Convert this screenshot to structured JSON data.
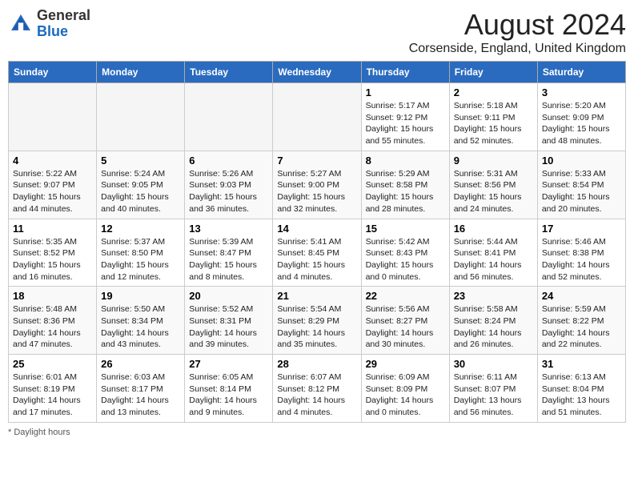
{
  "header": {
    "logo_line1": "General",
    "logo_line2": "Blue",
    "title": "August 2024",
    "subtitle": "Corsenside, England, United Kingdom"
  },
  "days_of_week": [
    "Sunday",
    "Monday",
    "Tuesday",
    "Wednesday",
    "Thursday",
    "Friday",
    "Saturday"
  ],
  "weeks": [
    [
      {
        "day": "",
        "info": ""
      },
      {
        "day": "",
        "info": ""
      },
      {
        "day": "",
        "info": ""
      },
      {
        "day": "",
        "info": ""
      },
      {
        "day": "1",
        "info": "Sunrise: 5:17 AM\nSunset: 9:12 PM\nDaylight: 15 hours and 55 minutes."
      },
      {
        "day": "2",
        "info": "Sunrise: 5:18 AM\nSunset: 9:11 PM\nDaylight: 15 hours and 52 minutes."
      },
      {
        "day": "3",
        "info": "Sunrise: 5:20 AM\nSunset: 9:09 PM\nDaylight: 15 hours and 48 minutes."
      }
    ],
    [
      {
        "day": "4",
        "info": "Sunrise: 5:22 AM\nSunset: 9:07 PM\nDaylight: 15 hours and 44 minutes."
      },
      {
        "day": "5",
        "info": "Sunrise: 5:24 AM\nSunset: 9:05 PM\nDaylight: 15 hours and 40 minutes."
      },
      {
        "day": "6",
        "info": "Sunrise: 5:26 AM\nSunset: 9:03 PM\nDaylight: 15 hours and 36 minutes."
      },
      {
        "day": "7",
        "info": "Sunrise: 5:27 AM\nSunset: 9:00 PM\nDaylight: 15 hours and 32 minutes."
      },
      {
        "day": "8",
        "info": "Sunrise: 5:29 AM\nSunset: 8:58 PM\nDaylight: 15 hours and 28 minutes."
      },
      {
        "day": "9",
        "info": "Sunrise: 5:31 AM\nSunset: 8:56 PM\nDaylight: 15 hours and 24 minutes."
      },
      {
        "day": "10",
        "info": "Sunrise: 5:33 AM\nSunset: 8:54 PM\nDaylight: 15 hours and 20 minutes."
      }
    ],
    [
      {
        "day": "11",
        "info": "Sunrise: 5:35 AM\nSunset: 8:52 PM\nDaylight: 15 hours and 16 minutes."
      },
      {
        "day": "12",
        "info": "Sunrise: 5:37 AM\nSunset: 8:50 PM\nDaylight: 15 hours and 12 minutes."
      },
      {
        "day": "13",
        "info": "Sunrise: 5:39 AM\nSunset: 8:47 PM\nDaylight: 15 hours and 8 minutes."
      },
      {
        "day": "14",
        "info": "Sunrise: 5:41 AM\nSunset: 8:45 PM\nDaylight: 15 hours and 4 minutes."
      },
      {
        "day": "15",
        "info": "Sunrise: 5:42 AM\nSunset: 8:43 PM\nDaylight: 15 hours and 0 minutes."
      },
      {
        "day": "16",
        "info": "Sunrise: 5:44 AM\nSunset: 8:41 PM\nDaylight: 14 hours and 56 minutes."
      },
      {
        "day": "17",
        "info": "Sunrise: 5:46 AM\nSunset: 8:38 PM\nDaylight: 14 hours and 52 minutes."
      }
    ],
    [
      {
        "day": "18",
        "info": "Sunrise: 5:48 AM\nSunset: 8:36 PM\nDaylight: 14 hours and 47 minutes."
      },
      {
        "day": "19",
        "info": "Sunrise: 5:50 AM\nSunset: 8:34 PM\nDaylight: 14 hours and 43 minutes."
      },
      {
        "day": "20",
        "info": "Sunrise: 5:52 AM\nSunset: 8:31 PM\nDaylight: 14 hours and 39 minutes."
      },
      {
        "day": "21",
        "info": "Sunrise: 5:54 AM\nSunset: 8:29 PM\nDaylight: 14 hours and 35 minutes."
      },
      {
        "day": "22",
        "info": "Sunrise: 5:56 AM\nSunset: 8:27 PM\nDaylight: 14 hours and 30 minutes."
      },
      {
        "day": "23",
        "info": "Sunrise: 5:58 AM\nSunset: 8:24 PM\nDaylight: 14 hours and 26 minutes."
      },
      {
        "day": "24",
        "info": "Sunrise: 5:59 AM\nSunset: 8:22 PM\nDaylight: 14 hours and 22 minutes."
      }
    ],
    [
      {
        "day": "25",
        "info": "Sunrise: 6:01 AM\nSunset: 8:19 PM\nDaylight: 14 hours and 17 minutes."
      },
      {
        "day": "26",
        "info": "Sunrise: 6:03 AM\nSunset: 8:17 PM\nDaylight: 14 hours and 13 minutes."
      },
      {
        "day": "27",
        "info": "Sunrise: 6:05 AM\nSunset: 8:14 PM\nDaylight: 14 hours and 9 minutes."
      },
      {
        "day": "28",
        "info": "Sunrise: 6:07 AM\nSunset: 8:12 PM\nDaylight: 14 hours and 4 minutes."
      },
      {
        "day": "29",
        "info": "Sunrise: 6:09 AM\nSunset: 8:09 PM\nDaylight: 14 hours and 0 minutes."
      },
      {
        "day": "30",
        "info": "Sunrise: 6:11 AM\nSunset: 8:07 PM\nDaylight: 13 hours and 56 minutes."
      },
      {
        "day": "31",
        "info": "Sunrise: 6:13 AM\nSunset: 8:04 PM\nDaylight: 13 hours and 51 minutes."
      }
    ]
  ],
  "footer": {
    "daylight_note": "Daylight hours"
  }
}
